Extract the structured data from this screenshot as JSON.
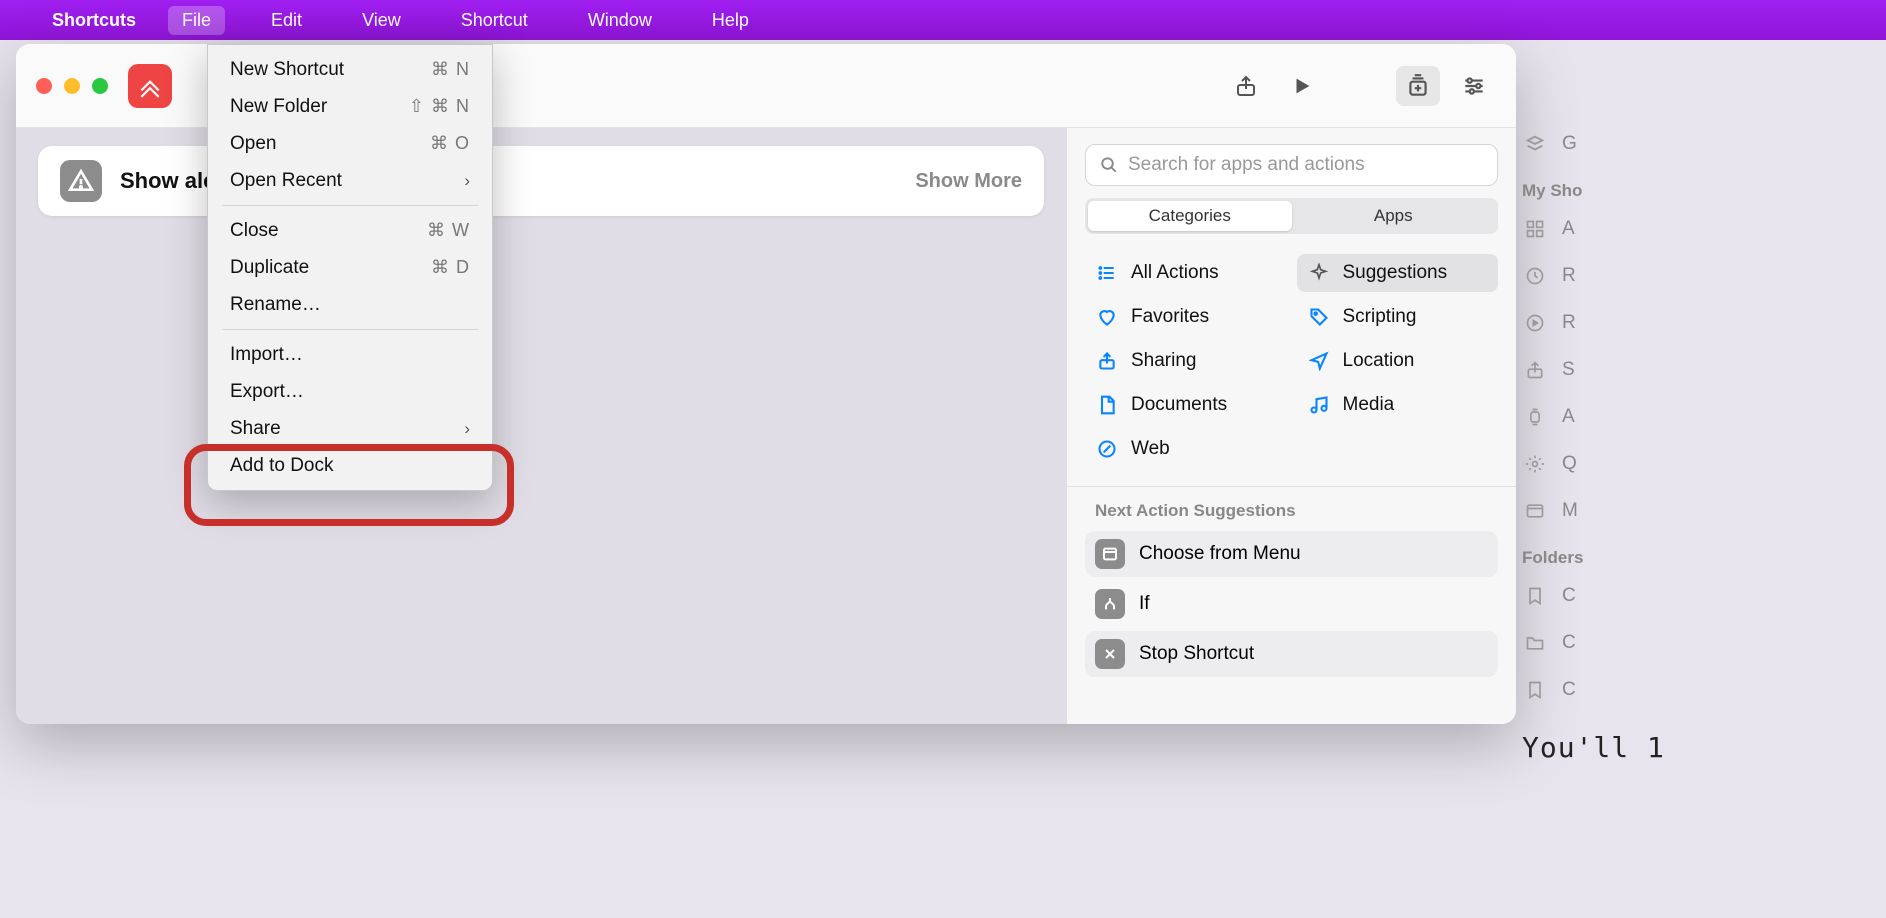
{
  "menubar": {
    "app": "Shortcuts",
    "items": [
      "File",
      "Edit",
      "View",
      "Shortcut",
      "Window",
      "Help"
    ],
    "active_index": 0
  },
  "dropdown": {
    "items": [
      {
        "label": "New Shortcut",
        "shortcut": "⌘ N"
      },
      {
        "label": "New Folder",
        "shortcut": "⇧ ⌘ N"
      },
      {
        "label": "Open",
        "shortcut": "⌘ O"
      },
      {
        "label": "Open Recent",
        "submenu": true
      },
      {
        "sep": true
      },
      {
        "label": "Close",
        "shortcut": "⌘ W"
      },
      {
        "label": "Duplicate",
        "shortcut": "⌘ D"
      },
      {
        "label": "Rename…"
      },
      {
        "sep": true
      },
      {
        "label": "Import…"
      },
      {
        "label": "Export…"
      },
      {
        "label": "Share",
        "submenu": true
      },
      {
        "label": "Add to Dock"
      }
    ],
    "highlight_index": 12
  },
  "editor": {
    "action_title": "Show aler",
    "show_more": "Show More"
  },
  "rightpanel": {
    "search_placeholder": "Search for apps and actions",
    "segmented": {
      "items": [
        "Categories",
        "Apps"
      ],
      "active": 0
    },
    "categories": [
      {
        "label": "All Actions",
        "icon": "list"
      },
      {
        "label": "Suggestions",
        "icon": "sparkle",
        "selected": true
      },
      {
        "label": "Favorites",
        "icon": "heart"
      },
      {
        "label": "Scripting",
        "icon": "tag"
      },
      {
        "label": "Sharing",
        "icon": "share"
      },
      {
        "label": "Location",
        "icon": "nav"
      },
      {
        "label": "Documents",
        "icon": "doc"
      },
      {
        "label": "Media",
        "icon": "note"
      },
      {
        "label": "Web",
        "icon": "safari"
      }
    ],
    "suggestions_header": "Next Action Suggestions",
    "suggestions": [
      {
        "label": "Choose from Menu",
        "alt": true
      },
      {
        "label": "If",
        "alt": false
      },
      {
        "label": "Stop Shortcut",
        "alt": true
      }
    ]
  },
  "far_sidebar": {
    "rows": [
      {
        "icon": "stack",
        "label": "G"
      },
      {
        "header": "My Sho"
      },
      {
        "icon": "grid",
        "label": "A"
      },
      {
        "icon": "clock",
        "label": "R"
      },
      {
        "icon": "play",
        "label": "R"
      },
      {
        "icon": "share",
        "label": "S"
      },
      {
        "icon": "watch",
        "label": "A"
      },
      {
        "icon": "gear",
        "label": "Q"
      },
      {
        "icon": "window",
        "label": "M"
      },
      {
        "header": "Folders"
      },
      {
        "icon": "bookmark",
        "label": "C"
      },
      {
        "icon": "folder",
        "label": "C"
      },
      {
        "icon": "bookmark",
        "label": "C"
      }
    ],
    "ending_text": "You'll  1"
  }
}
